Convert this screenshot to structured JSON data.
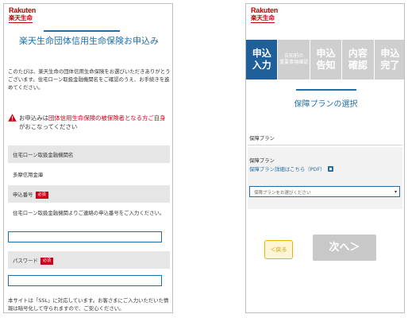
{
  "brand": {
    "name_en": "Rakuten",
    "name_ja": "楽天生命",
    "color": "#bf0000"
  },
  "accent": "#1f6fa9",
  "left_screen": {
    "title": "楽天生命団体信用生命保険お申込み",
    "intro": "このたびは、楽天生命の団体信用生命保険をお選びいただきありがとうございます。住宅ローン取扱金融機関名をご確認のうえ、お手続きを進めてください。",
    "notice": {
      "before": "お申込みは",
      "highlight": "団体信用生命保険の被保険者となる方ご自身",
      "after": "がおこなってください"
    },
    "bank_header": "住宅ローン取扱金融機関名",
    "bank_name": "多摩信用金庫",
    "app_number_label": "申込番号",
    "required_badge": "必須",
    "app_number_help": "住宅ローン取扱金融機関よりご連絡の申込番号をご入力ください。",
    "app_number_value": "",
    "password_label": "パスワード",
    "password_value": "",
    "footer_note": "本サイトは「SSL」に対応しています。お客さまにご入力いただいた情報は暗号化して守られますので、ご安心ください。"
  },
  "right_screen": {
    "steps": [
      {
        "label_line1": "申込",
        "label_line2": "入力",
        "active": true
      },
      {
        "label_line1": "告知前の",
        "label_line2": "重要事項確認",
        "active": false
      },
      {
        "label_line1": "申込",
        "label_line2": "告知",
        "active": false
      },
      {
        "label_line1": "内容",
        "label_line2": "確認",
        "active": false
      },
      {
        "label_line1": "申込",
        "label_line2": "完了",
        "active": false
      }
    ],
    "title": "保障プランの選択",
    "section_label": "保障プラン",
    "plan_label": "保障プラン",
    "plan_link": "保障プラン詳細はこちら（PDF）",
    "select_value": "保障プランをお選びください",
    "back_label": "＜戻る",
    "next_label": "次へ＞"
  }
}
